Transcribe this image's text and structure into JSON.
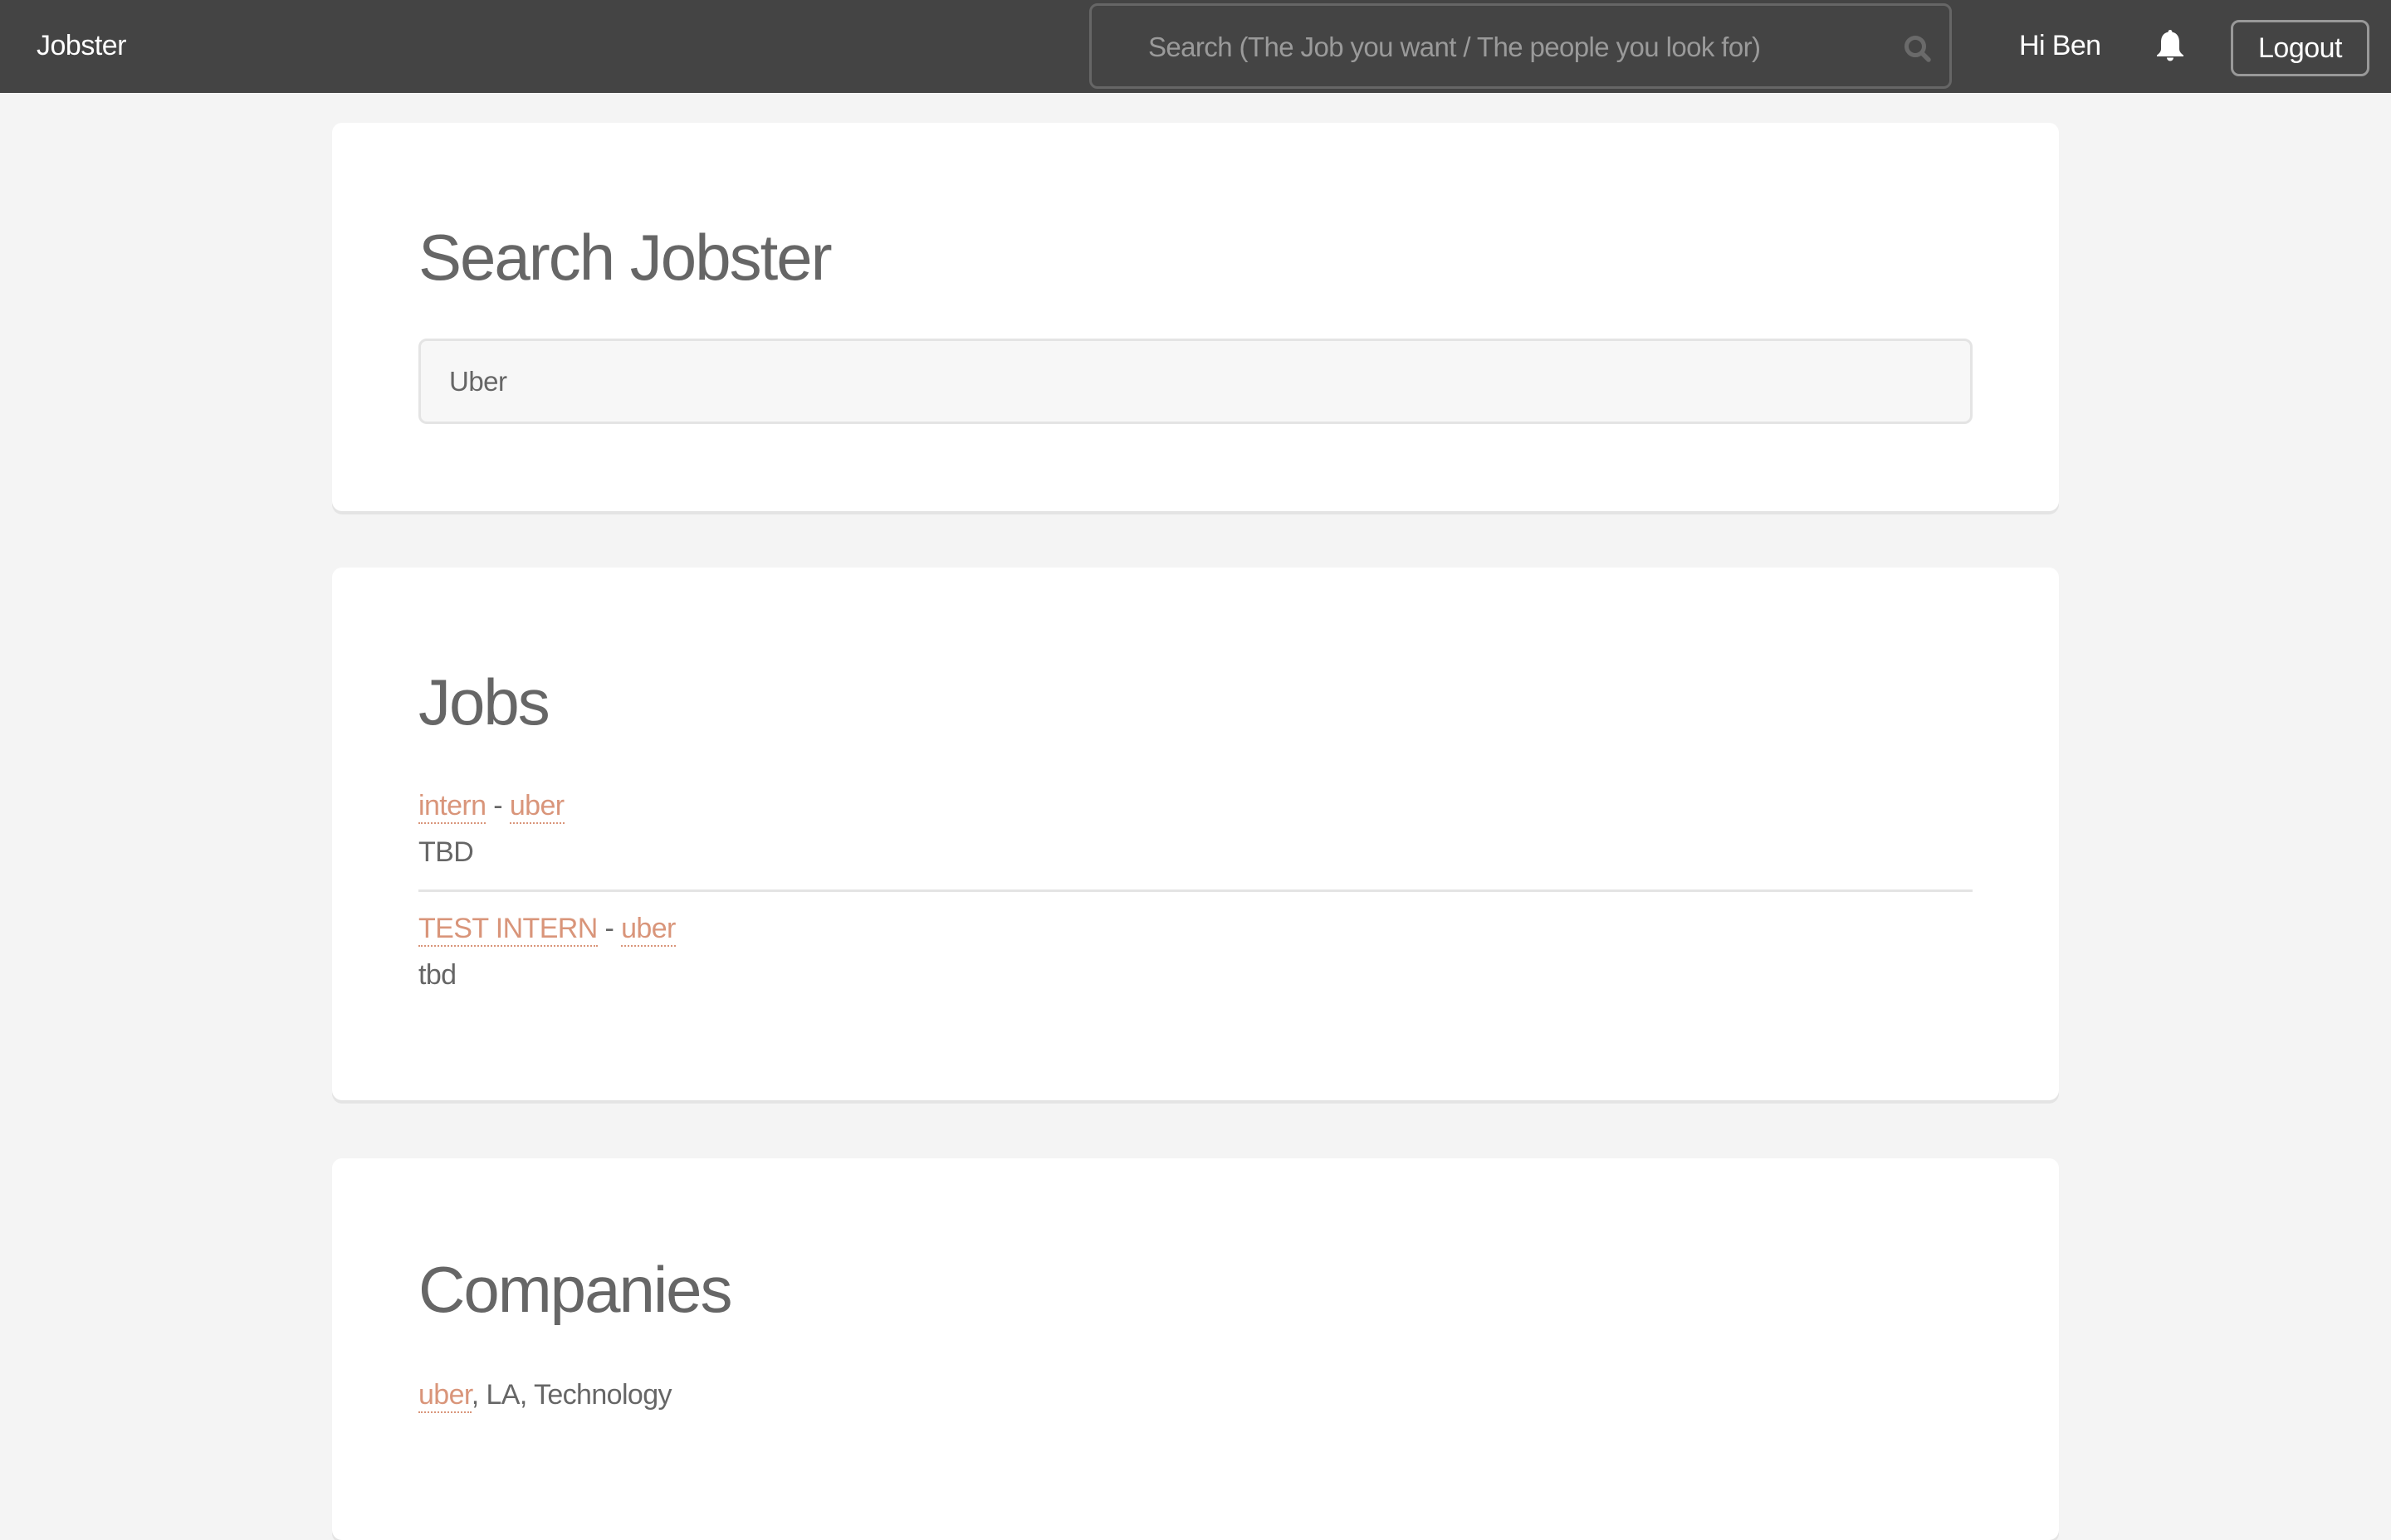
{
  "navbar": {
    "brand": "Jobster",
    "search_placeholder": "Search (The Job you want / The people you look for)",
    "search_value": "",
    "greeting": "Hi Ben",
    "notifications_icon": "bell-icon",
    "search_icon": "search-icon",
    "logout_label": "Logout"
  },
  "search_card": {
    "title": "Search Jobster",
    "query": "Uber"
  },
  "jobs_card": {
    "title": "Jobs",
    "separator": " - ",
    "items": [
      {
        "title": "intern",
        "company": "uber",
        "description": "TBD"
      },
      {
        "title": "TEST INTERN",
        "company": "uber",
        "description": "tbd"
      }
    ]
  },
  "companies_card": {
    "title": "Companies",
    "items": [
      {
        "name": "uber",
        "details": ", LA, Technology"
      }
    ]
  },
  "colors": {
    "navbar_bg": "#444444",
    "page_bg": "#f4f4f4",
    "link": "#d9957a",
    "text": "#666666"
  }
}
